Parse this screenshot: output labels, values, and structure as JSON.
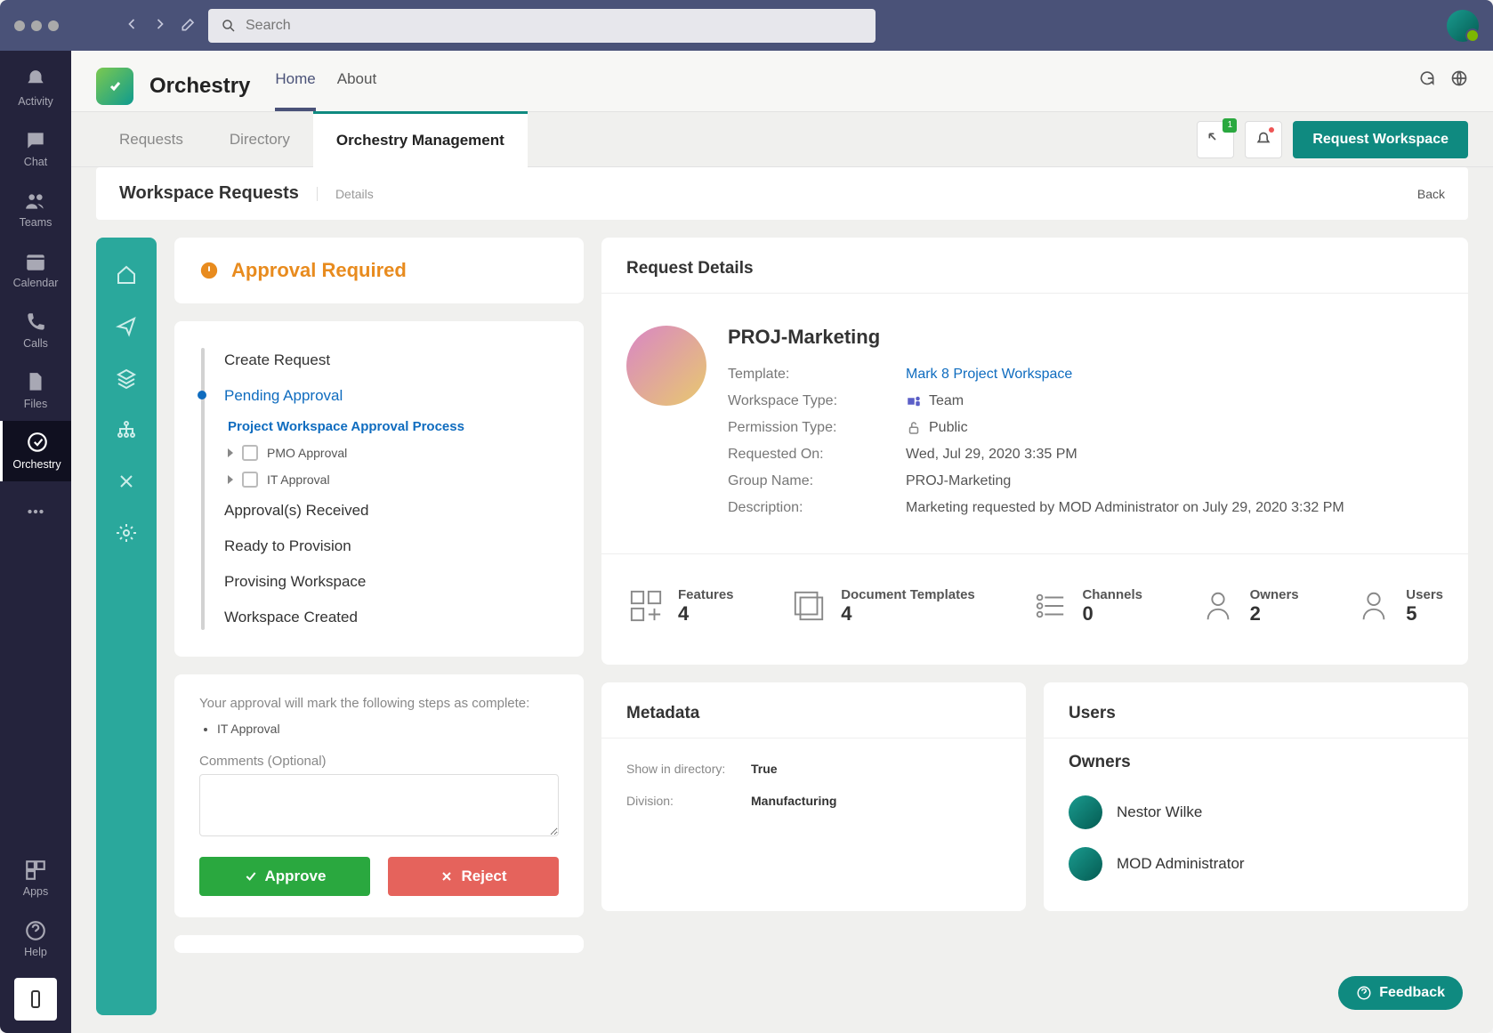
{
  "search_placeholder": "Search",
  "rail": [
    {
      "label": "Activity"
    },
    {
      "label": "Chat"
    },
    {
      "label": "Teams"
    },
    {
      "label": "Calendar"
    },
    {
      "label": "Calls"
    },
    {
      "label": "Files"
    },
    {
      "label": "Orchestry"
    }
  ],
  "rail_bottom": [
    {
      "label": "Apps"
    },
    {
      "label": "Help"
    }
  ],
  "app": {
    "title": "Orchestry",
    "nav": [
      {
        "label": "Home"
      },
      {
        "label": "About"
      }
    ]
  },
  "tabs": [
    {
      "label": "Requests"
    },
    {
      "label": "Directory"
    },
    {
      "label": "Orchestry Management"
    }
  ],
  "selector_badge": "1",
  "request_workspace_btn": "Request Workspace",
  "subheader": {
    "main": "Workspace Requests",
    "sub": "Details",
    "back": "Back"
  },
  "approval_banner": "Approval Required",
  "timeline": {
    "items": [
      "Create Request",
      "Pending Approval",
      "Approval(s) Received",
      "Ready to Provision",
      "Provising Workspace",
      "Workspace Created"
    ],
    "sub_title": "Project Workspace Approval Process",
    "sub_items": [
      "PMO Approval",
      "IT Approval"
    ]
  },
  "approval_box": {
    "note": "Your approval will mark the following steps as complete:",
    "items": [
      "IT Approval"
    ],
    "comments_label": "Comments (Optional)",
    "approve": "Approve",
    "reject": "Reject"
  },
  "details": {
    "title": "Request Details",
    "name": "PROJ-Marketing",
    "rows": [
      {
        "k": "Template:",
        "v": "Mark 8 Project Workspace",
        "link": true
      },
      {
        "k": "Workspace Type:",
        "v": "Team",
        "icon": "teams"
      },
      {
        "k": "Permission Type:",
        "v": "Public",
        "icon": "lock"
      },
      {
        "k": "Requested On:",
        "v": "Wed, Jul 29, 2020 3:35 PM"
      },
      {
        "k": "Group Name:",
        "v": "PROJ-Marketing"
      },
      {
        "k": "Description:",
        "v": "Marketing requested by MOD Administrator on July 29, 2020 3:32 PM"
      }
    ]
  },
  "stats": [
    {
      "label": "Features",
      "value": "4"
    },
    {
      "label": "Document Templates",
      "value": "4"
    },
    {
      "label": "Channels",
      "value": "0"
    },
    {
      "label": "Owners",
      "value": "2"
    },
    {
      "label": "Users",
      "value": "5"
    }
  ],
  "metadata": {
    "title": "Metadata",
    "rows": [
      {
        "k": "Show in directory:",
        "v": "True"
      },
      {
        "k": "Division:",
        "v": "Manufacturing"
      }
    ]
  },
  "users": {
    "title": "Users",
    "owners_title": "Owners",
    "owners": [
      "Nestor Wilke",
      "MOD Administrator"
    ]
  },
  "feedback": "Feedback"
}
